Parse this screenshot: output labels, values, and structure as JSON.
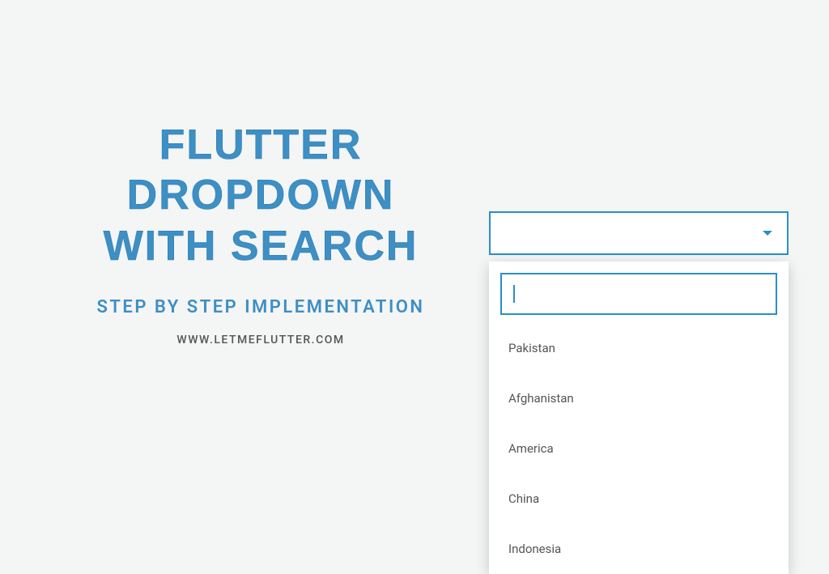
{
  "header": {
    "title_line1": "Flutter Dropdown",
    "title_line2": "With Search",
    "subtitle": "Step By Step Implementation",
    "url": "www.letmeflutter.com"
  },
  "dropdown": {
    "search_value": "",
    "items": [
      {
        "label": "Pakistan"
      },
      {
        "label": "Afghanistan"
      },
      {
        "label": "America"
      },
      {
        "label": "China"
      },
      {
        "label": "Indonesia"
      }
    ]
  },
  "colors": {
    "accent": "#2a8fc9",
    "title": "#3d8fc4",
    "background": "#f4f5f5"
  }
}
